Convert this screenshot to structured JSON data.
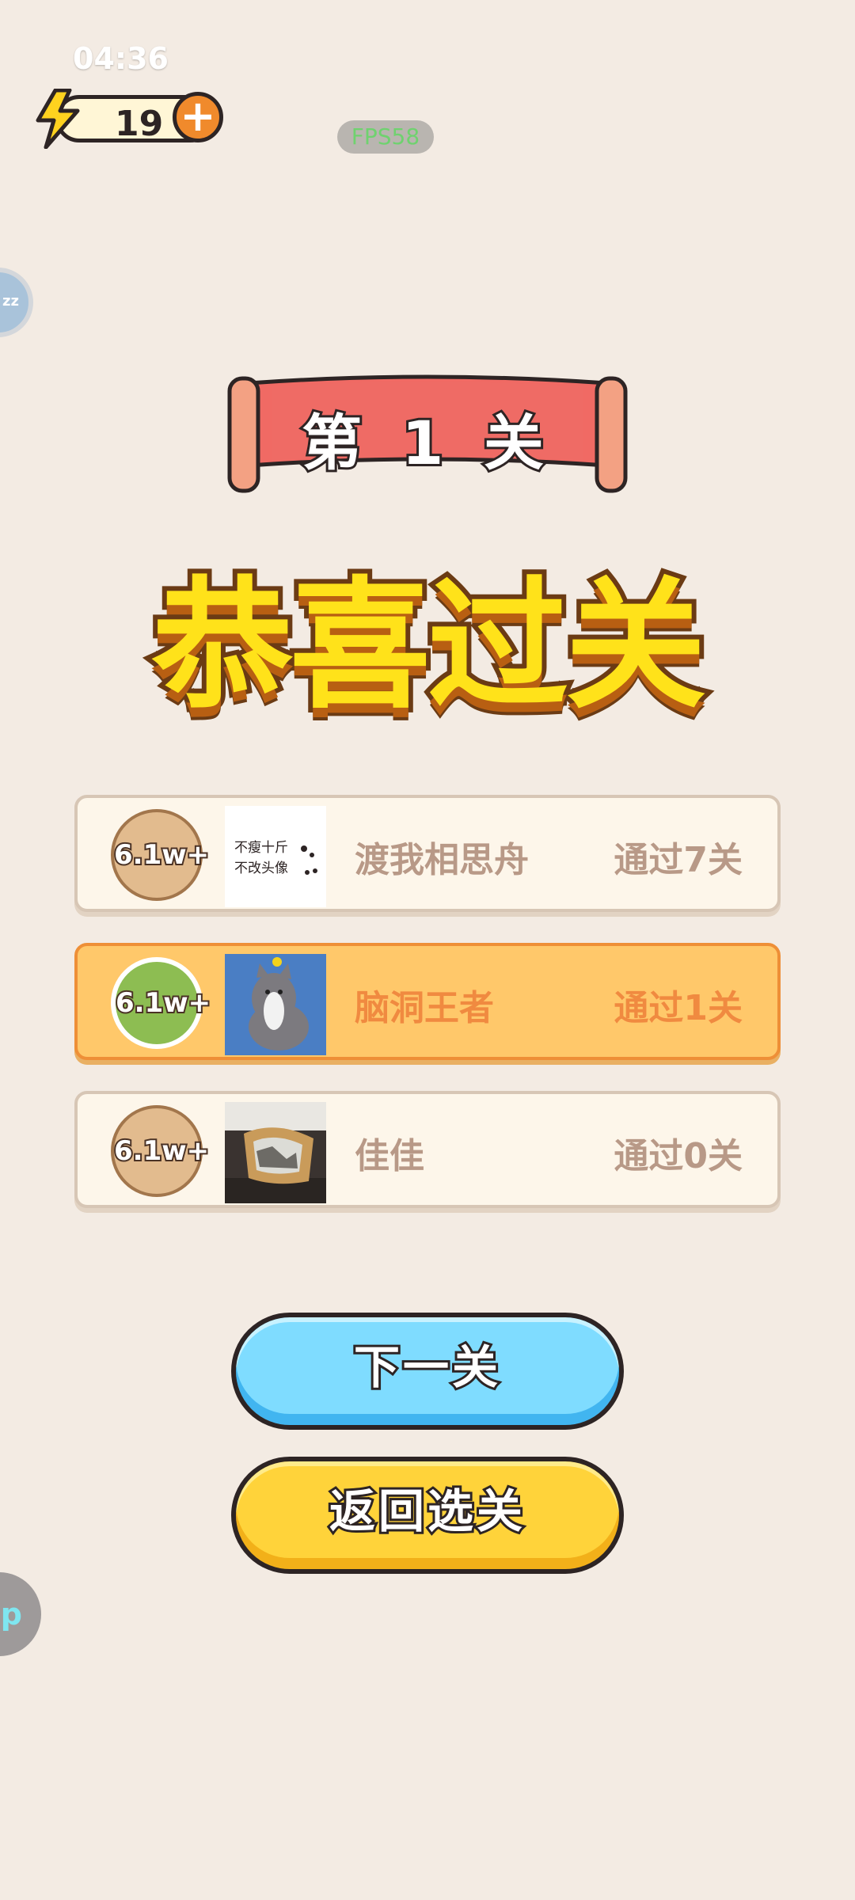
{
  "status": {
    "time": "04:36"
  },
  "energy": {
    "count": "19",
    "plus": "+"
  },
  "debug": {
    "fps": "FPS58"
  },
  "side": {
    "avatar_text": "zz",
    "up_text": "up"
  },
  "level": {
    "banner": "第 1 关",
    "headline": "恭喜过关"
  },
  "leaderboard": [
    {
      "badge": "6.1w+",
      "name": "渡我相思舟",
      "score": "通过7关",
      "avatar_text": [
        "不瘦十斤",
        "不改头像"
      ],
      "is_me": false
    },
    {
      "badge": "6.1w+",
      "name": "脑洞王者",
      "score": "通过1关",
      "avatar_text": [],
      "is_me": true
    },
    {
      "badge": "6.1w+",
      "name": "佳佳",
      "score": "通过0关",
      "avatar_text": [],
      "is_me": false
    }
  ],
  "buttons": {
    "next": "下一关",
    "back": "返回选关"
  },
  "colors": {
    "background": "#f3ebe3",
    "banner_red": "#f06a64",
    "headline_yellow": "#ffe21a",
    "highlight_card": "#ffc86a",
    "next_button": "#7fdcff",
    "back_button": "#ffd33a"
  }
}
